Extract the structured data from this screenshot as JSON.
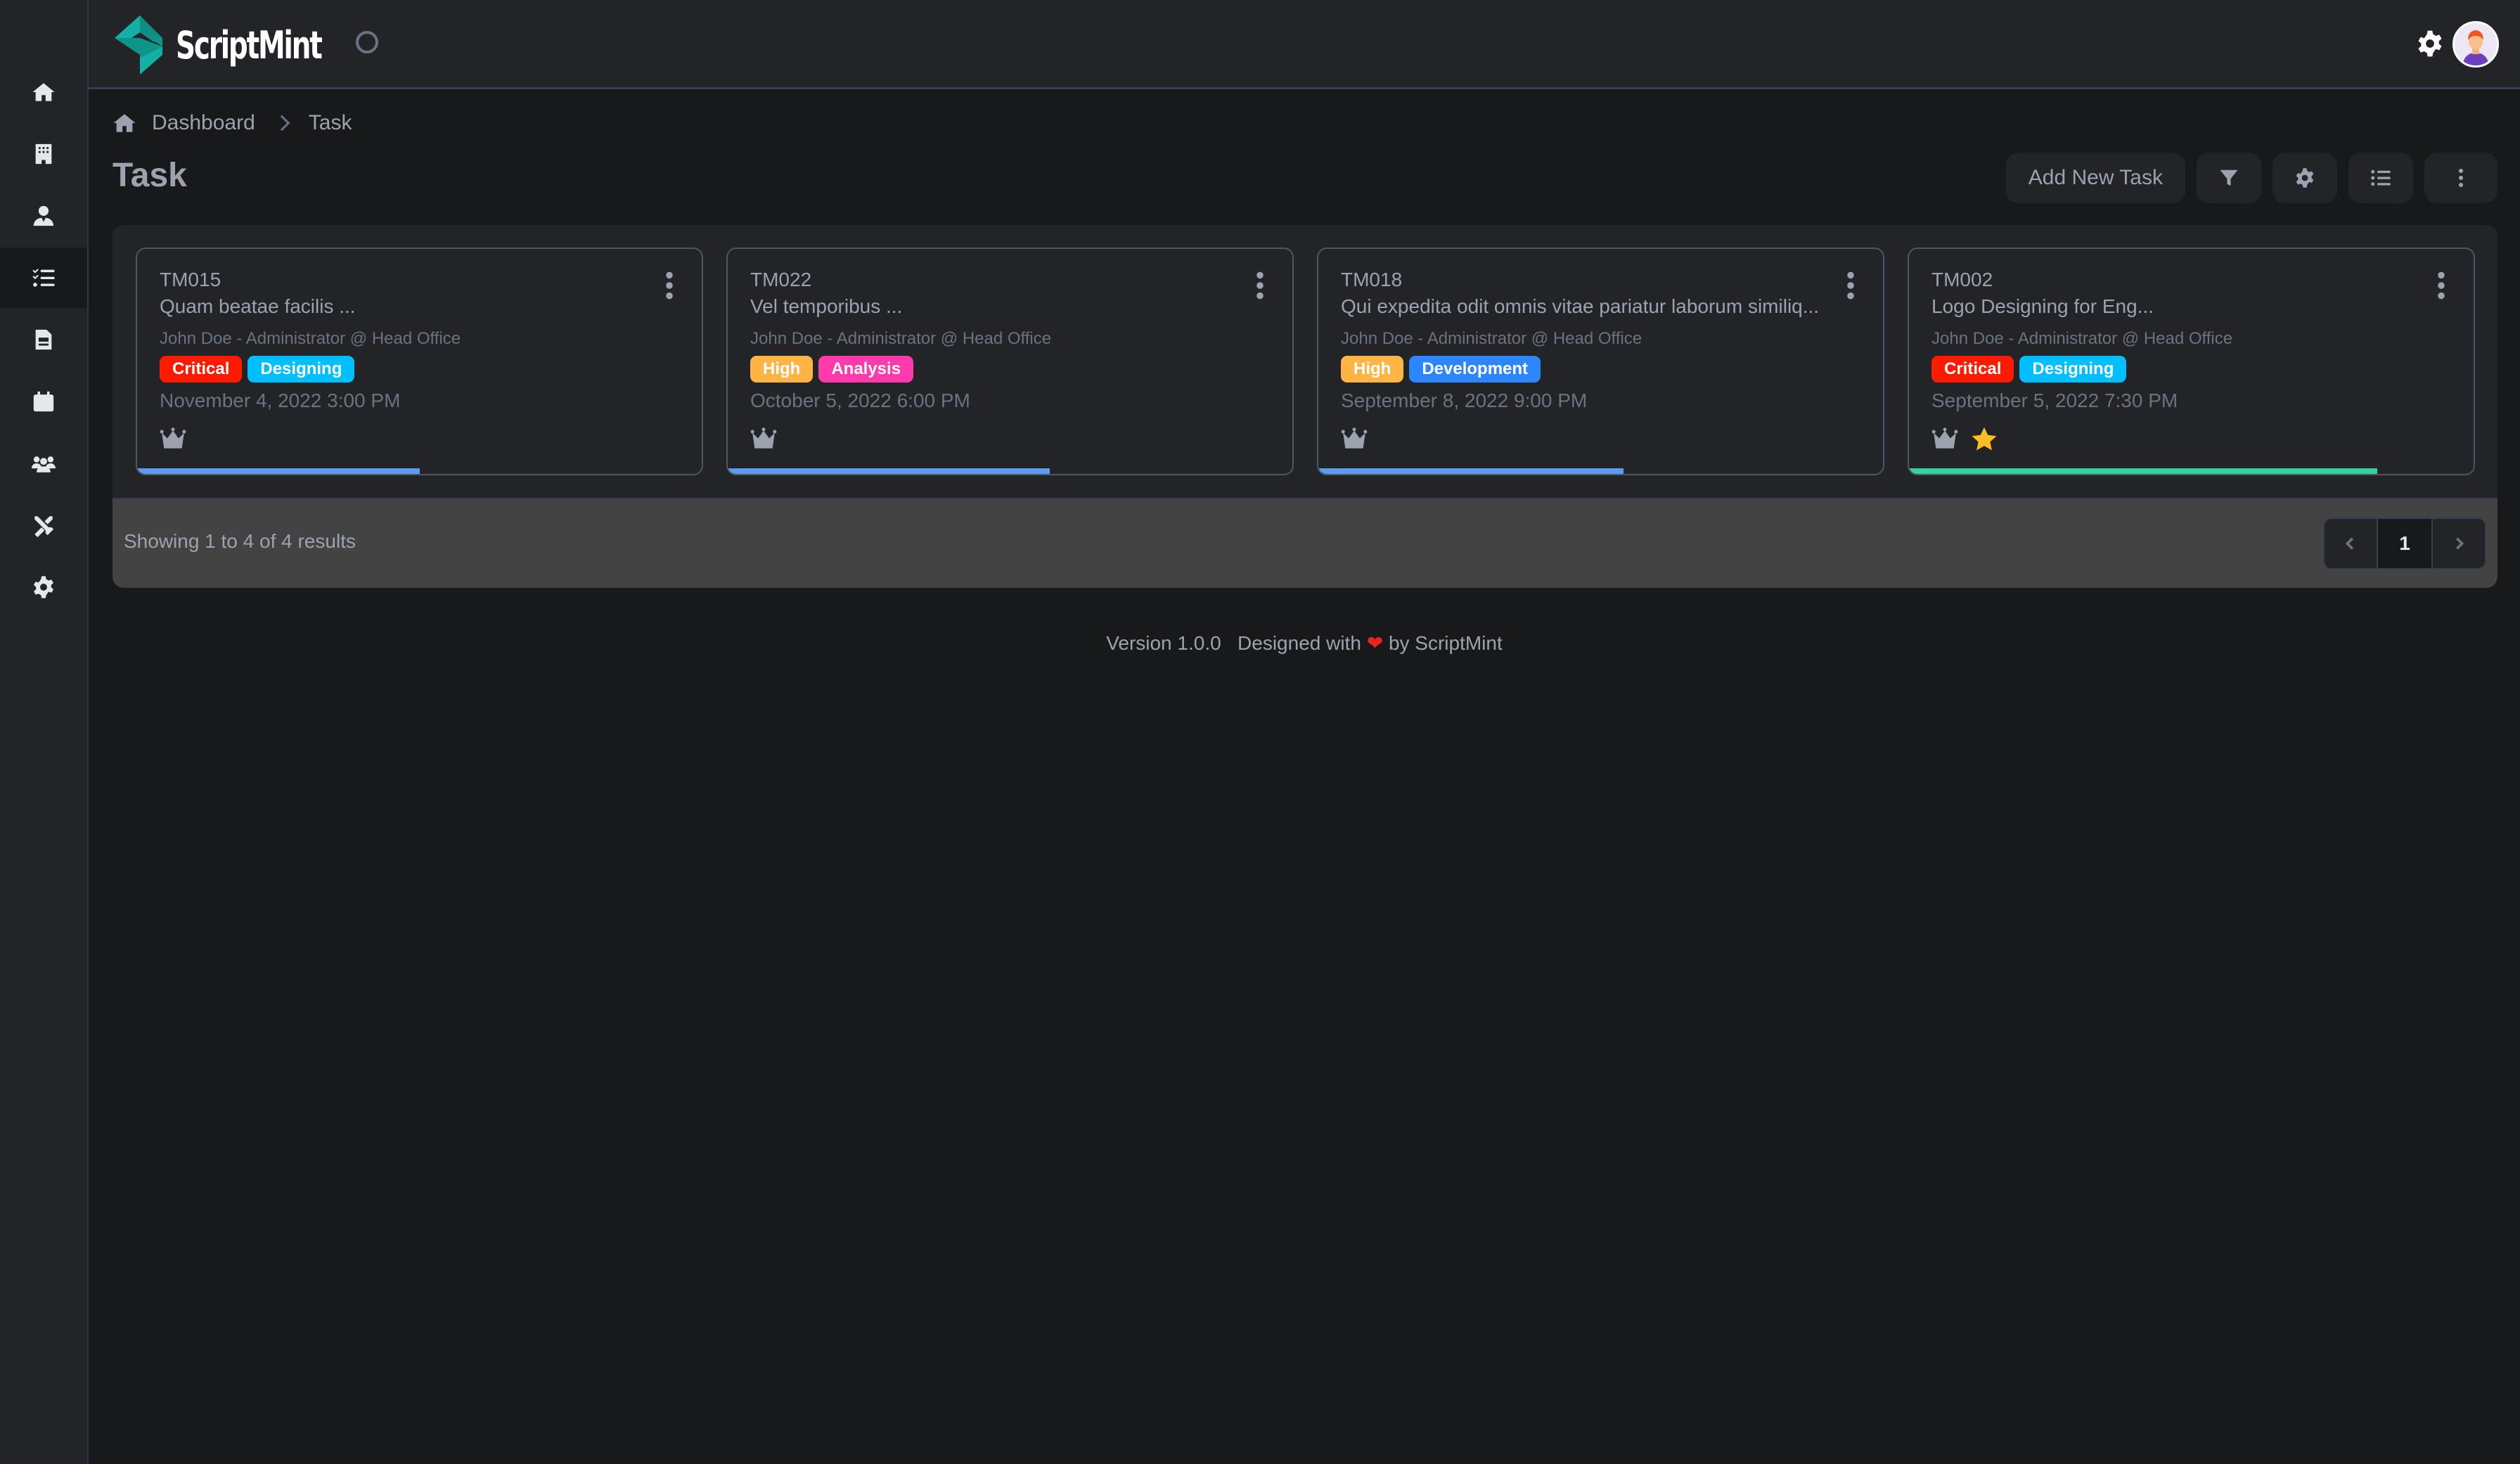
{
  "app": {
    "brand": "ScriptMint"
  },
  "sidebar": {
    "items": [
      {
        "label": "Home",
        "icon": "home-icon"
      },
      {
        "label": "Organization",
        "icon": "building-icon"
      },
      {
        "label": "Employee",
        "icon": "user-tie-icon"
      },
      {
        "label": "Task",
        "icon": "list-check-icon",
        "active": true
      },
      {
        "label": "Document",
        "icon": "file-icon"
      },
      {
        "label": "Calendar",
        "icon": "calendar-icon"
      },
      {
        "label": "Team",
        "icon": "users-icon"
      },
      {
        "label": "Utility",
        "icon": "tools-icon"
      },
      {
        "label": "Settings",
        "icon": "gear-icon"
      }
    ]
  },
  "breadcrumb": {
    "items": [
      "Dashboard",
      "Task"
    ]
  },
  "page": {
    "title": "Task"
  },
  "actions": {
    "add_label": "Add New Task",
    "filter_icon": "filter-icon",
    "settings_icon": "gear-icon",
    "list_icon": "list-icon",
    "more_icon": "more-vertical-icon"
  },
  "tasks": [
    {
      "code": "TM015",
      "title": "Quam beatae facilis ...",
      "owner": "John Doe - Administrator @ Head Office",
      "priority": {
        "label": "Critical",
        "color": "#ff1a00"
      },
      "category": {
        "label": "Designing",
        "color": "#00bfff"
      },
      "date": "November 4, 2022 3:00 PM",
      "icons": [
        "crown-icon"
      ],
      "progress_percent": 50,
      "progress_color": "#5a9cf0"
    },
    {
      "code": "TM022",
      "title": "Vel temporibus ...",
      "owner": "John Doe - Administrator @ Head Office",
      "priority": {
        "label": "High",
        "color": "#ffb444"
      },
      "category": {
        "label": "Analysis",
        "color": "#ff3aac"
      },
      "date": "October 5, 2022 6:00 PM",
      "icons": [
        "crown-icon"
      ],
      "progress_percent": 57,
      "progress_color": "#5a9cf0"
    },
    {
      "code": "TM018",
      "title": "Qui expedita odit omnis vitae pariatur laborum similiq...",
      "owner": "John Doe - Administrator @ Head Office",
      "priority": {
        "label": "High",
        "color": "#ffb444"
      },
      "category": {
        "label": "Development",
        "color": "#2d86ff"
      },
      "date": "September 8, 2022 9:00 PM",
      "icons": [
        "crown-icon"
      ],
      "progress_percent": 54,
      "progress_color": "#5a9cf0"
    },
    {
      "code": "TM002",
      "title": "Logo Designing for Eng...",
      "owner": "John Doe - Administrator @ Head Office",
      "priority": {
        "label": "Critical",
        "color": "#ff1a00"
      },
      "category": {
        "label": "Designing",
        "color": "#00bfff"
      },
      "date": "September 5, 2022 7:30 PM",
      "icons": [
        "crown-icon",
        "star-icon"
      ],
      "progress_percent": 83,
      "progress_color": "#34d399"
    }
  ],
  "pagination": {
    "summary": "Showing 1 to 4 of 4 results",
    "current_page": "1"
  },
  "footer": {
    "version": "Version 1.0.0",
    "designed_with": "Designed with",
    "heart": "❤",
    "by": "by ScriptMint"
  },
  "colors": {
    "brand": "#14a99c",
    "background": "#18191b",
    "surface": "#232427"
  }
}
